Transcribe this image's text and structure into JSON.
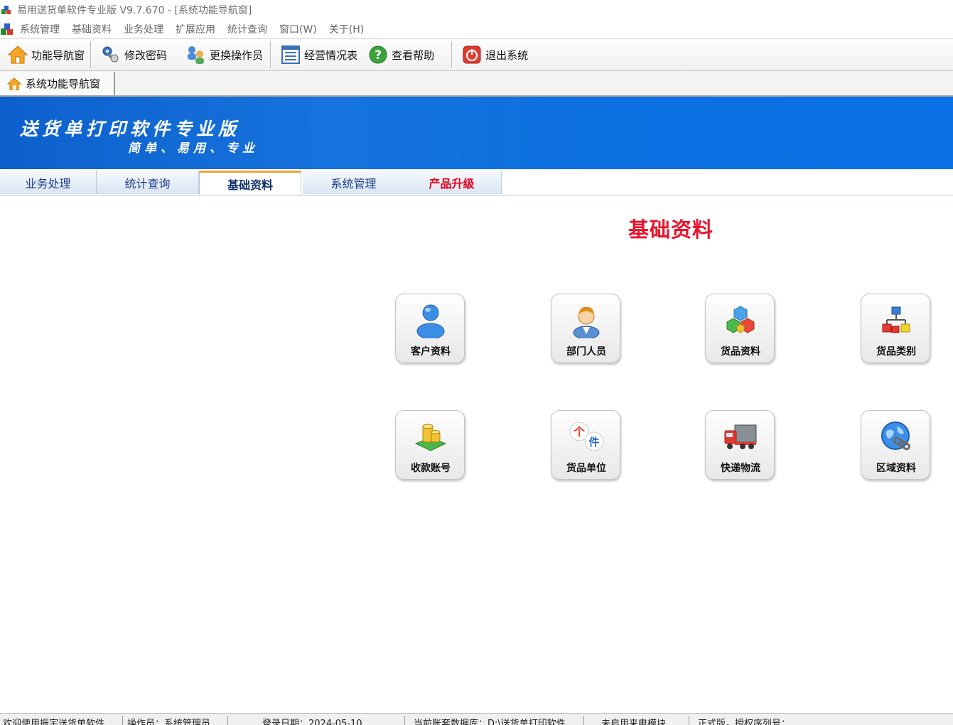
{
  "window": {
    "title": "易用送货单软件专业版 V9.7.670 - [系统功能导航窗]"
  },
  "menu": [
    {
      "label": "系统管理"
    },
    {
      "label": "基础资料"
    },
    {
      "label": "业务处理"
    },
    {
      "label": "扩展应用"
    },
    {
      "label": "统计查询"
    },
    {
      "label": "窗口(W)"
    },
    {
      "label": "关于(H)"
    }
  ],
  "toolbar": {
    "nav": "功能导航窗",
    "password": "修改密码",
    "switch_operator": "更换操作员",
    "report": "经营情况表",
    "help": "查看帮助",
    "exit": "退出系统"
  },
  "doc_tab": {
    "label": "系统功能导航窗"
  },
  "banner": {
    "title": "送货单打印软件专业版",
    "subtitle": "简单、易用、专业",
    "color": "#0d6ad8"
  },
  "nav_tabs": [
    {
      "label": "业务处理"
    },
    {
      "label": "统计查询"
    },
    {
      "label": "基础资料",
      "active": true
    },
    {
      "label": "系统管理"
    },
    {
      "label": "产品升级"
    }
  ],
  "section_title": "基础资料",
  "tiles": [
    {
      "label": "客户资料",
      "icon": "customer-icon"
    },
    {
      "label": "部门人员",
      "icon": "staff-icon"
    },
    {
      "label": "货品资料",
      "icon": "goods-icon"
    },
    {
      "label": "货品类别",
      "icon": "category-icon"
    },
    {
      "label": "收款账号",
      "icon": "coins-icon"
    },
    {
      "label": "货品单位",
      "icon": "unit-icon"
    },
    {
      "label": "快递物流",
      "icon": "truck-icon"
    },
    {
      "label": "区域资料",
      "icon": "globe-icon"
    }
  ],
  "unit_icon_glyphs": {
    "a": "个",
    "b": "件"
  },
  "status": {
    "welcome": "欢迎使用振宇送货单软件",
    "operator": "操作员：系统管理员",
    "login_date": "登录日期：2024-05-10",
    "database": "当前账套数据库：D:\\送货单打印软件",
    "modules": "未启用来电模块",
    "license": "正式版，授权序列号："
  },
  "colors": {
    "accent_red": "#e8142b",
    "tab_active_border": "#f0a331",
    "nav_text": "#1c3d8a"
  }
}
